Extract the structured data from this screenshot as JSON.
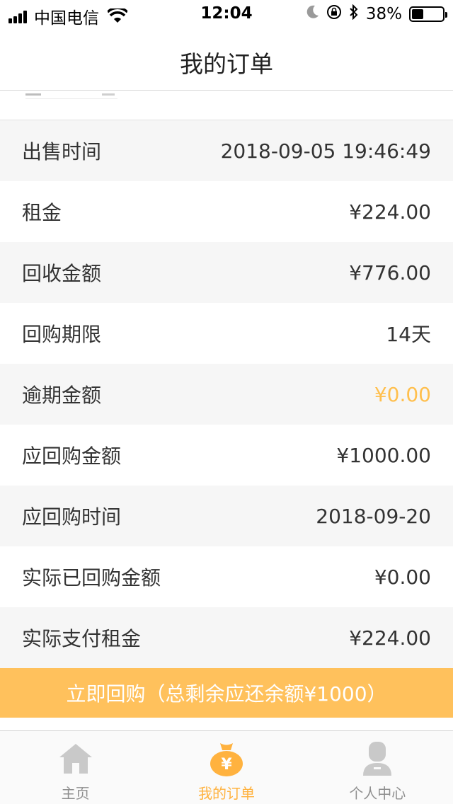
{
  "status_bar": {
    "carrier": "中国电信",
    "time": "12:04",
    "battery": "38%",
    "battery_level": 0.38
  },
  "nav": {
    "title": "我的订单"
  },
  "rows": [
    {
      "label": "出售时间",
      "value": "2018-09-05 19:46:49"
    },
    {
      "label": "租金",
      "value": "¥224.00"
    },
    {
      "label": "回收金额",
      "value": "¥776.00"
    },
    {
      "label": "回购期限",
      "value": "14天"
    },
    {
      "label": "逾期金额",
      "value": "¥0.00"
    },
    {
      "label": "应回购金额",
      "value": "¥1000.00"
    },
    {
      "label": "应回购时间",
      "value": "2018-09-20"
    },
    {
      "label": "实际已回购金额",
      "value": "¥0.00"
    },
    {
      "label": "实际支付租金",
      "value": "¥224.00"
    }
  ],
  "action": {
    "label": "立即回购（总剩余应还余额¥1000）"
  },
  "tabs": [
    {
      "label": "主页",
      "icon": "home-icon"
    },
    {
      "label": "我的订单",
      "icon": "money-bag-icon"
    },
    {
      "label": "个人中心",
      "icon": "user-icon"
    }
  ],
  "colors": {
    "accent": "#ffc15c",
    "highlight_value": "#ffbf4d",
    "tab_active": "#ffb23f",
    "tab_inactive": "#8f8f8f",
    "row_alt": "#f6f6f6"
  }
}
